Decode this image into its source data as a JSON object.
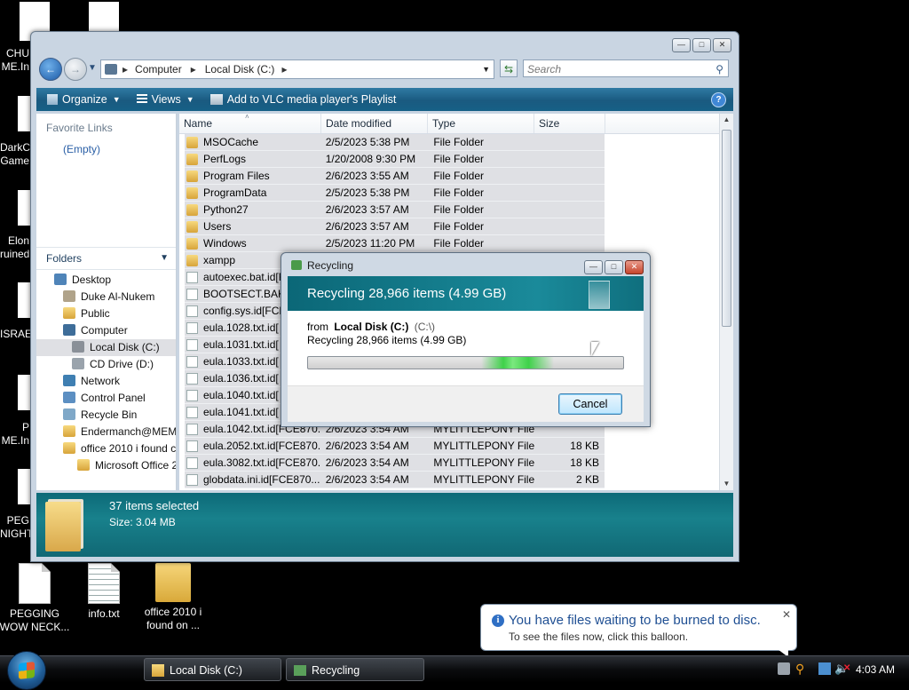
{
  "desktop": {
    "icons": [
      {
        "label": "PEGGING WOW NECK..."
      },
      {
        "label": "info.txt"
      },
      {
        "label": "office 2010 i found on ..."
      }
    ],
    "clipped_labels": [
      "CHU",
      "ME.In",
      "DarkC",
      "Game",
      "Elon",
      "ruined",
      "ISRAE",
      "P",
      "ME.In",
      "PEG",
      "NIGHT"
    ]
  },
  "explorer": {
    "breadcrumb": [
      "Computer",
      "Local Disk (C:)"
    ],
    "search_placeholder": "Search",
    "toolbar": {
      "organize": "Organize",
      "views": "Views",
      "vlc": "Add to VLC media player's Playlist"
    },
    "favorite_links": {
      "header": "Favorite Links",
      "empty": "(Empty)"
    },
    "folders": {
      "header": "Folders",
      "tree": [
        {
          "label": "Desktop",
          "icon": "desktop-icon"
        },
        {
          "label": "Duke Al-Nukem",
          "icon": "user-folder-icon"
        },
        {
          "label": "Public",
          "icon": "folder-icon"
        },
        {
          "label": "Computer",
          "icon": "computer-icon"
        },
        {
          "label": "Local Disk (C:)",
          "icon": "drive-icon"
        },
        {
          "label": "CD Drive (D:)",
          "icon": "cd-drive-icon"
        },
        {
          "label": "Network",
          "icon": "network-icon"
        },
        {
          "label": "Control Panel",
          "icon": "control-panel-icon"
        },
        {
          "label": "Recycle Bin",
          "icon": "recycle-bin-icon"
        },
        {
          "label": "Endermanch@MEM",
          "icon": "folder-icon"
        },
        {
          "label": "office 2010 i found c",
          "icon": "folder-icon"
        },
        {
          "label": "Microsoft Office 2",
          "icon": "folder-icon"
        }
      ]
    },
    "columns": [
      "Name",
      "Date modified",
      "Type",
      "Size"
    ],
    "files": [
      {
        "name": "MSOCache",
        "date": "2/5/2023 5:38 PM",
        "type": "File Folder",
        "size": "",
        "kind": "folder"
      },
      {
        "name": "PerfLogs",
        "date": "1/20/2008 9:30 PM",
        "type": "File Folder",
        "size": "",
        "kind": "folder"
      },
      {
        "name": "Program Files",
        "date": "2/6/2023 3:55 AM",
        "type": "File Folder",
        "size": "",
        "kind": "folder"
      },
      {
        "name": "ProgramData",
        "date": "2/5/2023 5:38 PM",
        "type": "File Folder",
        "size": "",
        "kind": "folder"
      },
      {
        "name": "Python27",
        "date": "2/6/2023 3:57 AM",
        "type": "File Folder",
        "size": "",
        "kind": "folder"
      },
      {
        "name": "Users",
        "date": "2/6/2023 3:57 AM",
        "type": "File Folder",
        "size": "",
        "kind": "folder"
      },
      {
        "name": "Windows",
        "date": "2/5/2023 11:20 PM",
        "type": "File Folder",
        "size": "",
        "kind": "folder"
      },
      {
        "name": "xampp",
        "date": "",
        "type": "",
        "size": "",
        "kind": "folder"
      },
      {
        "name": "autoexec.bat.id[F",
        "date": "",
        "type": "",
        "size": "",
        "kind": "file"
      },
      {
        "name": "BOOTSECT.BAK.i",
        "date": "",
        "type": "",
        "size": "",
        "kind": "file"
      },
      {
        "name": "config.sys.id[FCE",
        "date": "",
        "type": "",
        "size": "",
        "kind": "file"
      },
      {
        "name": "eula.1028.txt.id[",
        "date": "",
        "type": "",
        "size": "",
        "kind": "file"
      },
      {
        "name": "eula.1031.txt.id[",
        "date": "",
        "type": "",
        "size": "",
        "kind": "file"
      },
      {
        "name": "eula.1033.txt.id[",
        "date": "",
        "type": "",
        "size": "",
        "kind": "file"
      },
      {
        "name": "eula.1036.txt.id[",
        "date": "",
        "type": "",
        "size": "",
        "kind": "file"
      },
      {
        "name": "eula.1040.txt.id[",
        "date": "",
        "type": "",
        "size": "",
        "kind": "file"
      },
      {
        "name": "eula.1041.txt.id[",
        "date": "",
        "type": "",
        "size": "",
        "kind": "file"
      },
      {
        "name": "eula.1042.txt.id[FCE870...",
        "date": "2/6/2023 3:54 AM",
        "type": "MYLITTLEPONY File",
        "size": "",
        "kind": "file"
      },
      {
        "name": "eula.2052.txt.id[FCE870...",
        "date": "2/6/2023 3:54 AM",
        "type": "MYLITTLEPONY File",
        "size": "18 KB",
        "kind": "file"
      },
      {
        "name": "eula.3082.txt.id[FCE870...",
        "date": "2/6/2023 3:54 AM",
        "type": "MYLITTLEPONY File",
        "size": "18 KB",
        "kind": "file"
      },
      {
        "name": "globdata.ini.id[FCE870...",
        "date": "2/6/2023 3:54 AM",
        "type": "MYLITTLEPONY File",
        "size": "2 KB",
        "kind": "file"
      }
    ],
    "details": {
      "selected": "37 items selected",
      "size": "Size: 3.04 MB"
    }
  },
  "recycling": {
    "title": "Recycling",
    "heading": "Recycling 28,966 items (4.99 GB)",
    "from_label": "from",
    "from_bold": "Local Disk (C:)",
    "from_path": "(C:\\)",
    "status": "Recycling 28,966 items (4.99 GB)",
    "cancel": "Cancel"
  },
  "balloon": {
    "title": "You have files waiting to be burned to disc.",
    "subtitle": "To see the files now, click this balloon."
  },
  "taskbar": {
    "tasks": [
      "Local Disk (C:)",
      "Recycling"
    ],
    "clock": "4:03 AM"
  },
  "colors": {
    "toolbar": "#1a5a80",
    "details": "#18818c",
    "dialog_header": "#0b6777",
    "progress": "#3fd14a"
  }
}
